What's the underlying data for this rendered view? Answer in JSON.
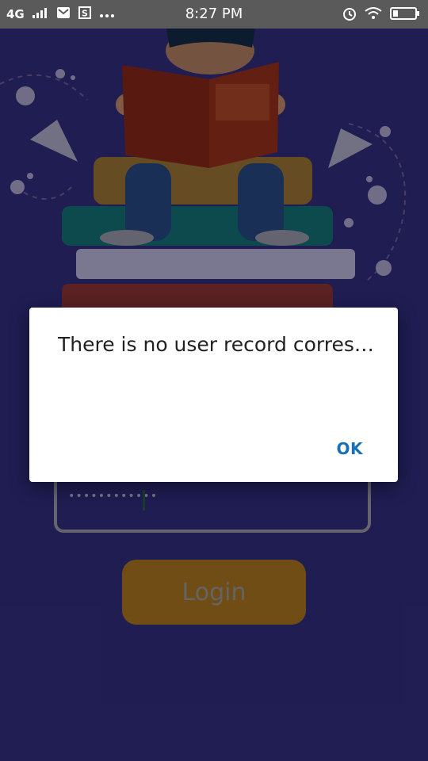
{
  "status_bar": {
    "network": "4G",
    "time": "8:27 PM",
    "icons": [
      "mail-icon",
      "s-badge-icon",
      "more-dots-icon",
      "alarm-icon",
      "wifi-icon",
      "battery-icon"
    ]
  },
  "login": {
    "password_mask": "••••••••••••",
    "button_label": "Login"
  },
  "dialog": {
    "message": "There is no user record corres…",
    "ok_label": "OK"
  },
  "colors": {
    "background": "#272464",
    "button": "#8a5f1c",
    "dialog_accent": "#1a6fb5"
  }
}
